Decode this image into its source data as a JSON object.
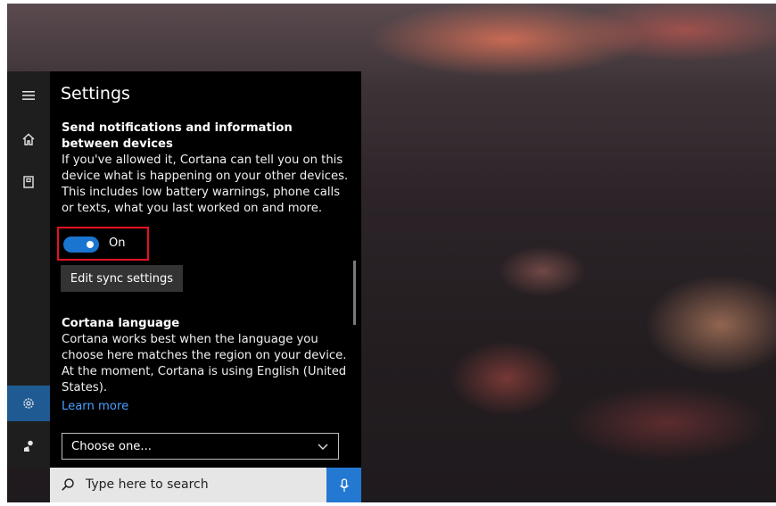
{
  "settings": {
    "title": "Settings",
    "section1": {
      "heading": "Send notifications and information between devices",
      "description": "If you've allowed it, Cortana can tell you on this device what is happening on your other devices. This includes low battery warnings, phone calls or texts, what you last worked on and more.",
      "toggle_state": "On",
      "edit_button": "Edit sync settings"
    },
    "section2": {
      "heading": "Cortana language",
      "description": "Cortana works best when the language you choose here matches the region on your device. At the moment, Cortana is using English (United States).",
      "link": "Learn more",
      "dropdown_value": "Choose one..."
    }
  },
  "taskbar": {
    "search_placeholder": "Type here to search"
  },
  "rail": {
    "icons": [
      "menu-icon",
      "home-icon",
      "notebook-icon",
      "settings-icon",
      "feedback-icon"
    ],
    "active": "settings-icon"
  },
  "colors": {
    "accent": "#1a75d1",
    "highlight": "#e81123",
    "panel": "#000000",
    "rail": "#1e1e1e",
    "active_rail": "#1f5a93"
  }
}
